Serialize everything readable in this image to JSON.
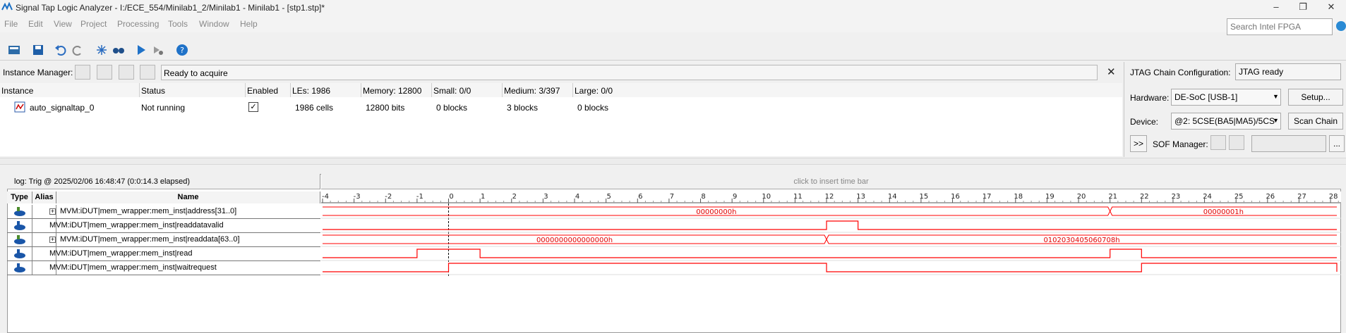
{
  "window": {
    "title": "Signal Tap Logic Analyzer - I:/ECE_554/Minilab1_2/Minilab1 - Minilab1 - [stp1.stp]*"
  },
  "menu": [
    "File",
    "Edit",
    "View",
    "Project",
    "Processing",
    "Tools",
    "Window",
    "Help"
  ],
  "search": {
    "placeholder": "Search Intel FPGA"
  },
  "instance_manager": {
    "label": "Instance Manager:",
    "status": "Ready to acquire",
    "headers": [
      "Instance",
      "Status",
      "Enabled",
      "LEs: 1986",
      "Memory: 12800",
      "Small: 0/0",
      "Medium: 3/397",
      "Large: 0/0"
    ],
    "row": {
      "instance": "auto_signaltap_0",
      "status": "Not running",
      "enabled": "✓",
      "les": "1986 cells",
      "memory": "12800 bits",
      "small": "0 blocks",
      "medium": "3 blocks",
      "large": "0 blocks"
    }
  },
  "jtag": {
    "config_label": "JTAG Chain Configuration:",
    "config_status": "JTAG ready",
    "hardware_label": "Hardware:",
    "hardware_value": "DE-SoC [USB-1]",
    "setup_label": "Setup...",
    "device_label": "Device:",
    "device_value": "@2: 5CSE(BA5|MA5)/5CS",
    "scan_label": "Scan Chain",
    "expand_label": ">>",
    "sof_label": "SOF Manager:",
    "ellipsis": "..."
  },
  "waveform": {
    "log_label": "log: Trig @ 2025/02/06 16:48:47 (0:0:14.3 elapsed)",
    "timebar_hint": "click to insert time bar",
    "col_type": "Type",
    "col_alias": "Alias",
    "col_name": "Name",
    "ticks": [
      "-4",
      "-3",
      "-2",
      "-1",
      "0",
      "1",
      "2",
      "3",
      "4",
      "5",
      "6",
      "7",
      "8",
      "9",
      "10",
      "11",
      "12",
      "13",
      "14",
      "15",
      "16",
      "17",
      "18",
      "19",
      "20",
      "21",
      "22",
      "23",
      "24",
      "25",
      "26",
      "27",
      "28"
    ],
    "signals": [
      {
        "name": "MVM:iDUT|mem_wrapper:mem_inst|address[31..0]",
        "bus": true,
        "values": [
          "00000000h",
          "00000001h"
        ],
        "transitions": [
          21
        ]
      },
      {
        "name": "MVM:iDUT|mem_wrapper:mem_inst|readdatavalid",
        "bus": false,
        "high": [
          [
            12,
            13
          ]
        ]
      },
      {
        "name": "MVM:iDUT|mem_wrapper:mem_inst|readdata[63..0]",
        "bus": true,
        "values": [
          "0000000000000000h",
          "0102030405060708h"
        ],
        "transitions": [
          12
        ]
      },
      {
        "name": "MVM:iDUT|mem_wrapper:mem_inst|read",
        "bus": false,
        "high": [
          [
            -1,
            1
          ],
          [
            21,
            22
          ]
        ]
      },
      {
        "name": "MVM:iDUT|mem_wrapper:mem_inst|waitrequest",
        "bus": false,
        "high": [
          [
            0,
            12
          ],
          [
            22,
            28.2
          ]
        ]
      }
    ],
    "colors": {
      "wave": "#ff0000",
      "bus_text": "#e00000"
    }
  }
}
